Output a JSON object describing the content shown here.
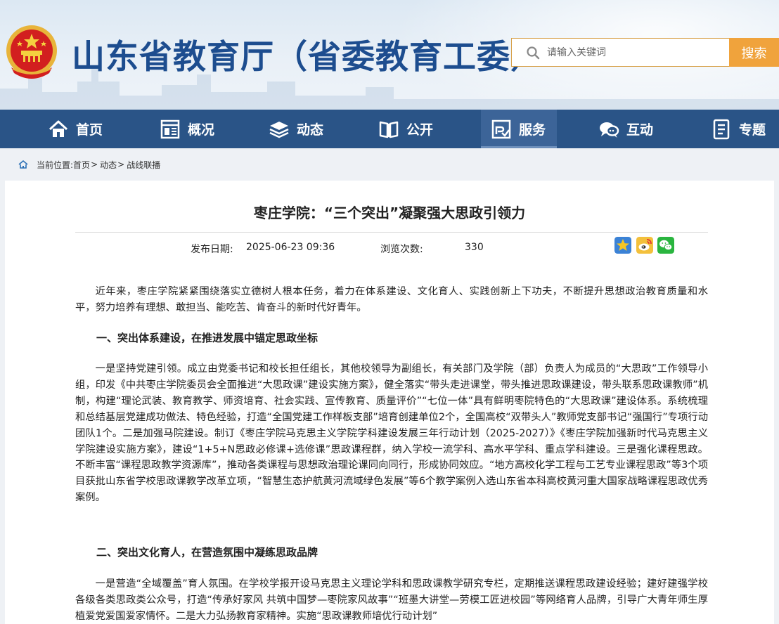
{
  "header": {
    "site_title": "山东省教育厅（省委教育工委）",
    "search_placeholder": "请输入关键词",
    "search_button": "搜索"
  },
  "nav": {
    "items": [
      {
        "label": "首页",
        "icon": "home-icon"
      },
      {
        "label": "概况",
        "icon": "overview-icon"
      },
      {
        "label": "动态",
        "icon": "news-stack-icon"
      },
      {
        "label": "公开",
        "icon": "open-book-icon"
      },
      {
        "label": "服务",
        "icon": "service-icon"
      },
      {
        "label": "互动",
        "icon": "chat-icon"
      },
      {
        "label": "专题",
        "icon": "topic-icon"
      }
    ],
    "active": "服务"
  },
  "breadcrumb": {
    "prefix": "当前位置:",
    "items": [
      "首页",
      "动态",
      "战线联播"
    ],
    "sep": ">"
  },
  "article": {
    "title": "枣庄学院：“三个突出”凝聚强大思政引领力",
    "publish_label": "发布日期:",
    "publish_date": "2025-06-23 09:36",
    "views_label": "浏览次数:",
    "views": "330",
    "share_icons": [
      "qzone-icon",
      "weibo-icon",
      "wechat-icon"
    ],
    "intro": "近年来，枣庄学院紧紧围绕落实立德树人根本任务，着力在体系建设、文化育人、实践创新上下功夫，不断提升思想政治教育质量和水平，努力培养有理想、敢担当、能吃苦、肯奋斗的新时代好青年。",
    "section1_heading": "一、突出体系建设，在推进发展中锚定思政坐标",
    "section1_body": "一是坚持党建引领。成立由党委书记和校长担任组长，其他校领导为副组长，有关部门及学院（部）负责人为成员的“大思政”工作领导小组，印发《中共枣庄学院委员会全面推进“大思政课”建设实施方案》，健全落实“带头走进课堂，带头推进思政课建设，带头联系思政课教师”机制，构建“理论武装、教育教学、师资培育、社会实践、宣传教育、质量评价”“七位一体”具有鲜明枣院特色的“大思政课”建设体系。系统梳理和总结基层党建成功做法、特色经验，打造“全国党建工作样板支部”培育创建单位2个，全国高校“双带头人”教师党支部书记“强国行”专项行动团队1个。二是加强马院建设。制订《枣庄学院马克思主义学院学科建设发展三年行动计划（2025-2027）》《枣庄学院加强新时代马克思主义学院建设实施方案》，建设“1+5+N思政必修课+选修课”思政课程群，纳入学校一流学科、高水平学科、重点学科建设。三是强化课程思政。不断丰富“课程思政教学资源库”，推动各类课程与思想政治理论课同向同行，形成协同效应。“地方高校化学工程与工艺专业课程思政”等3个项目获批山东省学校思政课教学改革立项，“智慧生态护航黄河流域绿色发展”等6个教学案例入选山东省本科高校黄河重大国家战略课程思政优秀案例。",
    "section2_heading": "二、突出文化育人，在营造氛围中凝练思政品牌",
    "section2_body": "一是营造“全域覆盖”育人氛围。在学校学报开设马克思主义理论学科和思政课教学研究专栏，定期推送课程思政建设经验；建好建强学校各级各类思政类公众号，打造“传承好家风 共筑中国梦—枣院家风故事”“班墨大讲堂—劳模工匠进校园”等网络育人品牌，引导广大青年师生厚植爱党爱国爱家情怀。二是大力弘扬教育家精神。实施“思政课教师培优行动计划”"
  }
}
